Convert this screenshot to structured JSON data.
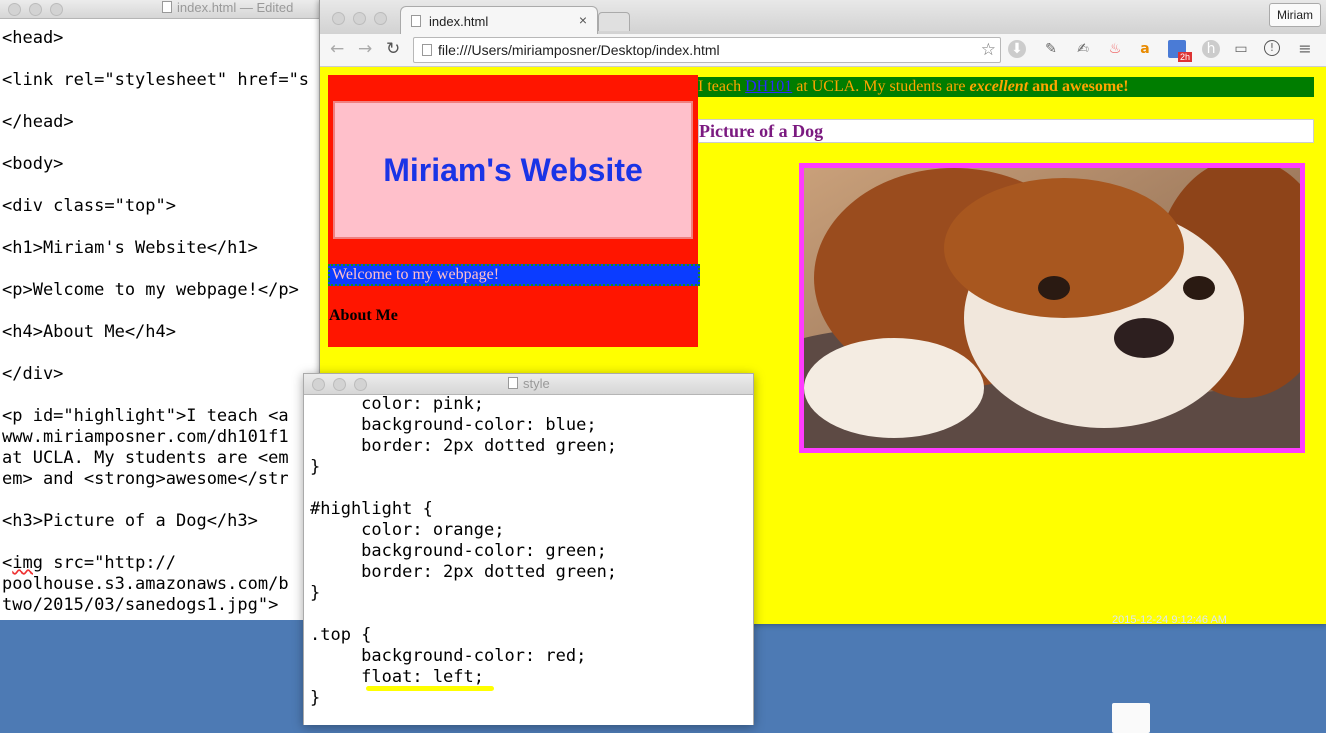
{
  "textedit": {
    "title": "index.html",
    "edited": " — Edited",
    "lines": [
      "<head>",
      "",
      "<link rel=\"stylesheet\" href=\"s",
      "",
      "</head>",
      "",
      "<body>",
      "",
      "<div class=\"top\">",
      "",
      "<h1>Miriam's Website</h1>",
      "",
      "<p>Welcome to my webpage!</p>",
      "",
      "<h4>About Me</h4>",
      "",
      "</div>",
      "",
      "<p id=\"highlight\">I teach <a",
      "www.miriamposner.com/dh101f1",
      "at UCLA. My students are <em",
      "em> and <strong>awesome</str",
      "",
      "<h3>Picture of a Dog</h3>",
      "",
      "<img src=\"http://",
      "poolhouse.s3.amazonaws.com/b",
      "two/2015/03/sanedogs1.jpg\">"
    ]
  },
  "browser": {
    "tab_title": "index.html",
    "tab_close": "×",
    "profile": "Miriam",
    "url": "file:///Users/miriamposner/Desktop/index.html",
    "nav_back": "←",
    "nav_forward": "→",
    "nav_reload": "↻",
    "star": "☆",
    "ext_badge": "2h",
    "menu": "≡"
  },
  "page": {
    "h1": "Miriam's Website",
    "welcome": "Welcome to my webpage!",
    "about": "About Me",
    "highlight_before": "I teach ",
    "highlight_link": "DH101",
    "highlight_mid": " at UCLA. My students are ",
    "highlight_em": "excellent",
    "highlight_and": " and ",
    "highlight_strong": "awesome",
    "highlight_end": "!",
    "h3": "Picture of a Dog"
  },
  "stylewin": {
    "title": "style",
    "lines": [
      "     color: pink;",
      "     background-color: blue;",
      "     border: 2px dotted green;",
      "}",
      "",
      "#highlight {",
      "     color: orange;",
      "     background-color: green;",
      "     border: 2px dotted green;",
      "}",
      "",
      ".top {",
      "     background-color: red;",
      "     float: left;",
      "}"
    ]
  },
  "desktop": {
    "label": "2015-12-24 9:12:46 AM"
  },
  "colors": {
    "page_bg": "#ffff00",
    "top_bg": "#ff1500",
    "h1_bg": "#ffc0cb",
    "h1_text": "#1a34e6",
    "welcome_bg": "#0b3cff",
    "highlight_bg": "#007d00",
    "highlight_text": "#ffa500",
    "h3_text": "#7b1a80",
    "img_border": "#ff3cff",
    "desktop": "#4d7ab4"
  }
}
